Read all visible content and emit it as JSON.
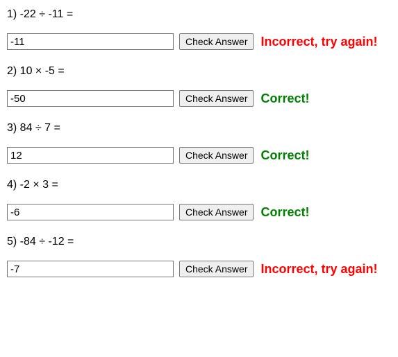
{
  "problems": [
    {
      "prompt": "1) -22 ÷ -11 =",
      "value": "-11",
      "button": "Check Answer",
      "feedback": "Incorrect, try again!",
      "status": "incorrect"
    },
    {
      "prompt": "2) 10 × -5 =",
      "value": "-50",
      "button": "Check Answer",
      "feedback": "Correct!",
      "status": "correct"
    },
    {
      "prompt": "3) 84 ÷ 7 =",
      "value": "12",
      "button": "Check Answer",
      "feedback": "Correct!",
      "status": "correct"
    },
    {
      "prompt": "4) -2 × 3 =",
      "value": "-6",
      "button": "Check Answer",
      "feedback": "Correct!",
      "status": "correct"
    },
    {
      "prompt": "5) -84 ÷ -12 =",
      "value": "-7",
      "button": "Check Answer",
      "feedback": "Incorrect, try again!",
      "status": "incorrect"
    }
  ]
}
